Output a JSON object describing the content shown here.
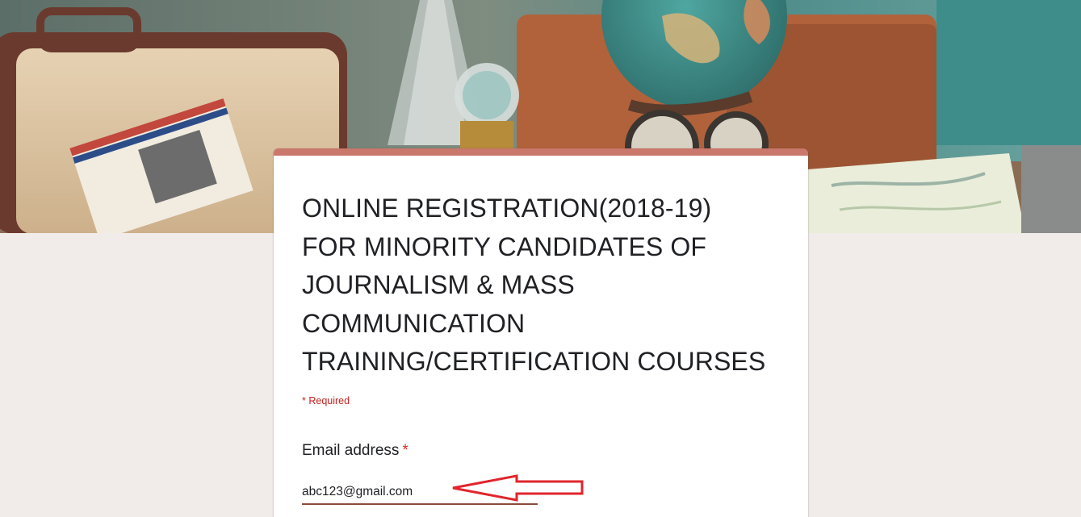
{
  "form": {
    "title_lines": [
      "ONLINE REGISTRATION(2018-19)",
      "FOR MINORITY CANDIDATES OF",
      "JOURNALISM & MASS",
      "COMMUNICATION",
      "TRAINING/CERTIFICATION COURSES"
    ],
    "required_note": "* Required",
    "accent_color": "#c9786b",
    "questions": [
      {
        "label": "Email address",
        "required_marker": "*",
        "value": "abc123@gmail.com"
      }
    ]
  },
  "annotation": {
    "type": "arrow",
    "color": "#e0252c",
    "points_to": "email-input"
  }
}
